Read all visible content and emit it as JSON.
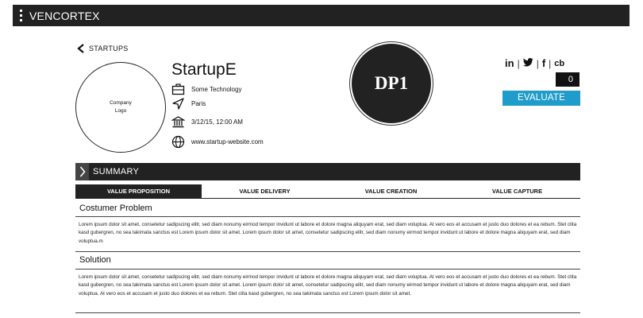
{
  "app": {
    "title": "VENCORTEX"
  },
  "nav": {
    "back_label": "STARTUPS"
  },
  "startup": {
    "logo_text": "Company\nLogo",
    "name": "StartupE",
    "industry": "Some Technology",
    "location": "Paris",
    "date": "3/12/15, 12:00 AM",
    "website": "www.startup-website.com"
  },
  "badge": {
    "text": "DP1"
  },
  "social": {
    "linkedin": "in",
    "twitter": "𝕥",
    "facebook": "f",
    "crunchbase": "cb",
    "sep": "|"
  },
  "evaluation": {
    "count": "0",
    "button_label": "EVALUATE"
  },
  "summary": {
    "label": "SUMMARY"
  },
  "tabs": [
    {
      "label": "VALUE PROPOSITION",
      "active": true
    },
    {
      "label": "VALUE DELIVERY",
      "active": false
    },
    {
      "label": "VALUE CREATION",
      "active": false
    },
    {
      "label": "VALUE CAPTURE",
      "active": false
    }
  ],
  "sections": [
    {
      "title": "Costumer Problem",
      "text": "Lorem ipsum dolor sit amet, consetetur sadipscing elitr, sed diam nonumy eirmod tempor invidunt ut labore et dolore magna aliquyam erat, sed diam voluptua. At vero eos et accusam et justo duo dolores et ea rebum. Stet clita kasd gubergren, no sea takimata sanctus est Lorem ipsum dolor sit amet. Lorem ipsum dolor sit amet, consetetur sadipscing elitr, sed diam nonumy eirmod tempor invidunt ut labore et dolore magna aliquyam erat, sed diam voluptua.m"
    },
    {
      "title": "Solution",
      "text": "Lorem ipsum dolor sit amet, consetetur sadipscing elitr, sed diam nonumy eirmod tempor invidunt ut labore et dolore magna aliquyam erat, sed diam voluptua. At vero eos et accusam et justo duo dolores et ea rebum. Stet clita kasd gubergren, no sea takimata sanctus est Lorem ipsum dolor sit amet. Lorem ipsum dolor sit amet, consetetur sadipscing elitr, sed diam nonumy eirmod tempor invidunt ut labore et dolore magna aliquyam erat, sed diam voluptua. At vero eos et accusam et justo duo dolores et ea rebum. Stet clita kasd gubergren, no sea takimata sanctus est Lorem ipsum dolor sit amet."
    }
  ]
}
